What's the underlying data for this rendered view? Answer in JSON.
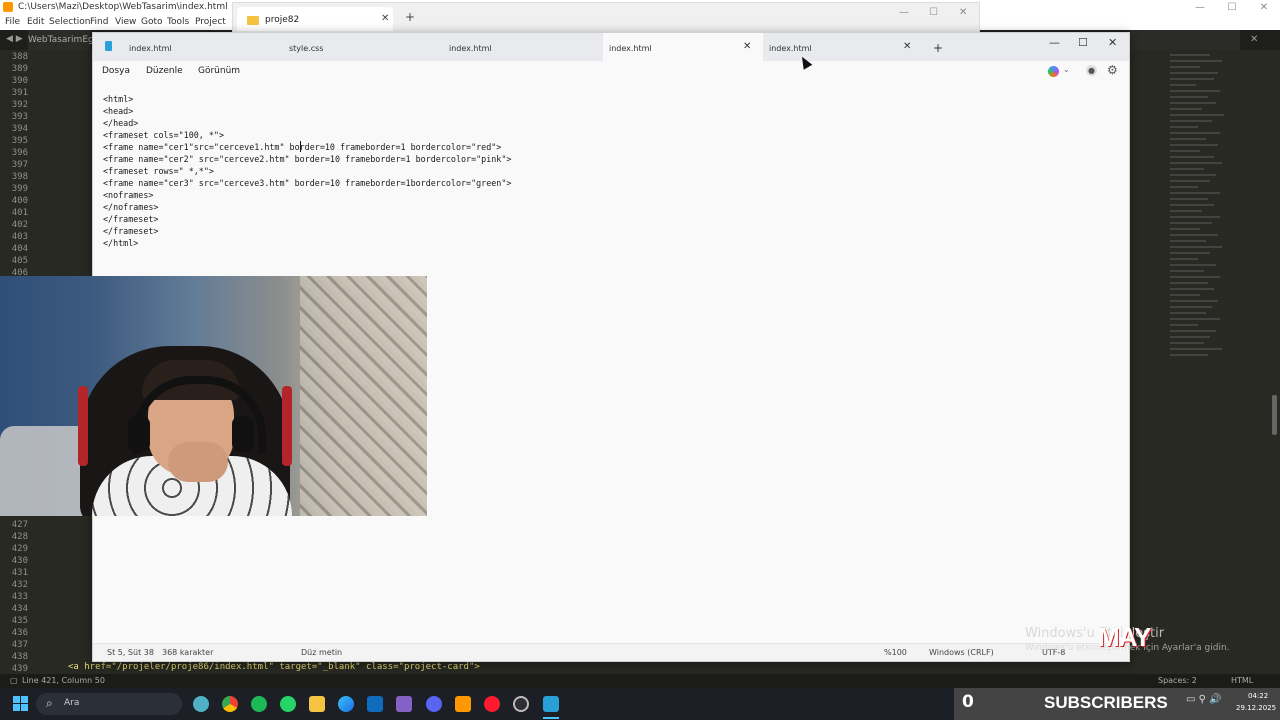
{
  "sublime": {
    "title": "C:\\Users\\Mazi\\Desktop\\WebTasarim\\index.html • - Sublime T",
    "menu": [
      "File",
      "Edit",
      "Selection",
      "Find",
      "View",
      "Goto",
      "Tools",
      "Project"
    ],
    "tab_label": "WebTasarimEgze",
    "line_numbers_top": [
      "388",
      "389",
      "390",
      "391",
      "392",
      "393",
      "394",
      "395",
      "396",
      "397",
      "398",
      "399",
      "400",
      "401",
      "402",
      "403",
      "404",
      "405",
      "406"
    ],
    "line_numbers_bottom": [
      "427",
      "428",
      "429",
      "430",
      "431",
      "432",
      "433",
      "434",
      "435",
      "436",
      "437",
      "438",
      "439"
    ],
    "code_bottom": "<a href=\"/projeler/proje86/index.html\" target=\"_blank\" class=\"project-card\">",
    "status_left": "Line 421, Column 50",
    "status_spaces": "Spaces: 2",
    "status_syntax": "HTML"
  },
  "explorer": {
    "tab_label": "proje82"
  },
  "notepad": {
    "tabs": [
      {
        "label": "index.html",
        "active": false
      },
      {
        "label": "style.css",
        "active": false
      },
      {
        "label": "index.html",
        "active": false
      },
      {
        "label": "index.html",
        "active": true
      },
      {
        "label": "index.html",
        "active": false
      }
    ],
    "menu": [
      "Dosya",
      "Düzenle",
      "Görünüm"
    ],
    "lines": [
      "<html>",
      "<head>",
      "</head>",
      "<frameset cols=\"100, *\">",
      "<frame name=\"cer1\"src=\"cerceve1.htm\" border=10 frameborder=1 bordercolor=\"red\">",
      "<frame name=\"cer2\" src=\"cerceve2.htm\" border=10 frameborder=1 bordercolor=\"pink\">",
      "<frameset rows=\" *,*\">",
      "<frame name=\"cer3\" src=\"cerceve3.htm\" border=10 frameborder=1bordercolor=\"green\">",
      "<noframes>",
      "</noframes>",
      "</frameset>",
      "</frameset>",
      "</html>"
    ],
    "status": {
      "position": "St 5, Süt 38",
      "chars": "368 karakter",
      "format": "Düz metin",
      "zoom": "%100",
      "line_ending": "Windows (CRLF)",
      "encoding": "UTF-8"
    }
  },
  "overlay": {
    "watermark_title": "Windows'u Etkinleştir",
    "watermark_sub": "Windows'u etkinleştirmek için Ayarlar'a gidin.",
    "logo": "MAY",
    "subscribers_count": "0",
    "subscribers_label": "SUBSCRIBERS"
  },
  "taskbar": {
    "search_placeholder": "Ara",
    "icons": [
      "copilot-icon",
      "chrome-icon",
      "spotify-icon",
      "whatsapp-icon",
      "file-explorer-icon",
      "edge-icon",
      "store-icon",
      "visual-studio-icon",
      "discord-icon",
      "sublime-icon",
      "opera-icon",
      "obs-icon",
      "notepad-icon"
    ],
    "time": "04:22",
    "date": "29.12.2025"
  }
}
